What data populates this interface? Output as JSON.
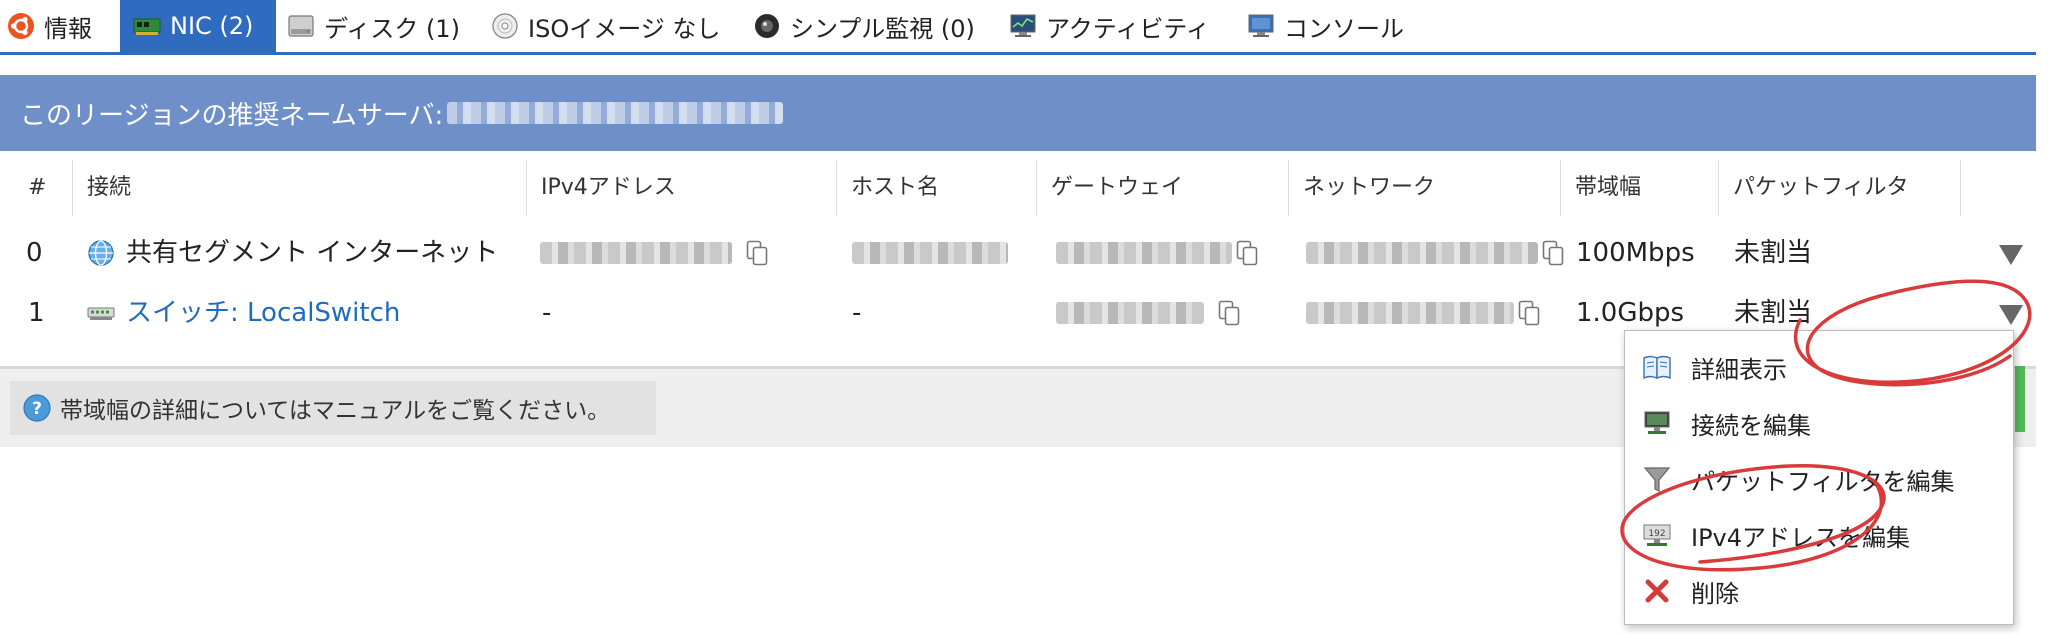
{
  "tabs": [
    {
      "label": "情報",
      "icon": "ubuntu-icon",
      "active": false
    },
    {
      "label": "NIC (2)",
      "icon": "nic-card-icon",
      "active": true
    },
    {
      "label": "ディスク (1)",
      "icon": "disk-icon",
      "active": false
    },
    {
      "label": "ISOイメージ なし",
      "icon": "cd-icon",
      "active": false
    },
    {
      "label": "シンプル監視 (0)",
      "icon": "monitor-camera-icon",
      "active": false
    },
    {
      "label": "アクティビティ",
      "icon": "activity-monitor-icon",
      "active": false
    },
    {
      "label": "コンソール",
      "icon": "console-icon",
      "active": false
    }
  ],
  "banner": {
    "text": "このリージョンの推奨ネームサーバ:"
  },
  "table": {
    "headers": [
      "#",
      "接続",
      "IPv4アドレス",
      "ホスト名",
      "ゲートウェイ",
      "ネットワーク",
      "帯域幅",
      "パケットフィルタ"
    ],
    "rows": [
      {
        "index": "0",
        "connection": "共有セグメント インターネット",
        "connection_icon": "globe-icon",
        "ipv4": "",
        "hostname": "",
        "gateway": "",
        "network": "",
        "bandwidth": "100Mbps",
        "packet_filter": "未割当"
      },
      {
        "index": "1",
        "connection": "スイッチ: LocalSwitch",
        "connection_icon": "switch-icon",
        "ipv4": "-",
        "hostname": "-",
        "gateway": "",
        "network": "",
        "bandwidth": "1.0Gbps",
        "packet_filter": "未割当"
      }
    ]
  },
  "footer": {
    "note": "帯域幅の詳細についてはマニュアルをご覧ください。"
  },
  "menu": {
    "items": [
      {
        "label": "詳細表示",
        "icon": "book-icon"
      },
      {
        "label": "接続を編集",
        "icon": "network-edit-icon"
      },
      {
        "label": "パケットフィルタを編集",
        "icon": "filter-funnel-icon"
      },
      {
        "label": "IPv4アドレスを編集",
        "icon": "ip-edit-icon"
      },
      {
        "label": "削除",
        "icon": "delete-x-icon"
      }
    ]
  },
  "colors": {
    "accent": "#2f6bbf",
    "banner": "#6f8fc9",
    "link": "#1e6bbf",
    "annotation": "#d93a3a",
    "status_green": "#52b95a"
  }
}
